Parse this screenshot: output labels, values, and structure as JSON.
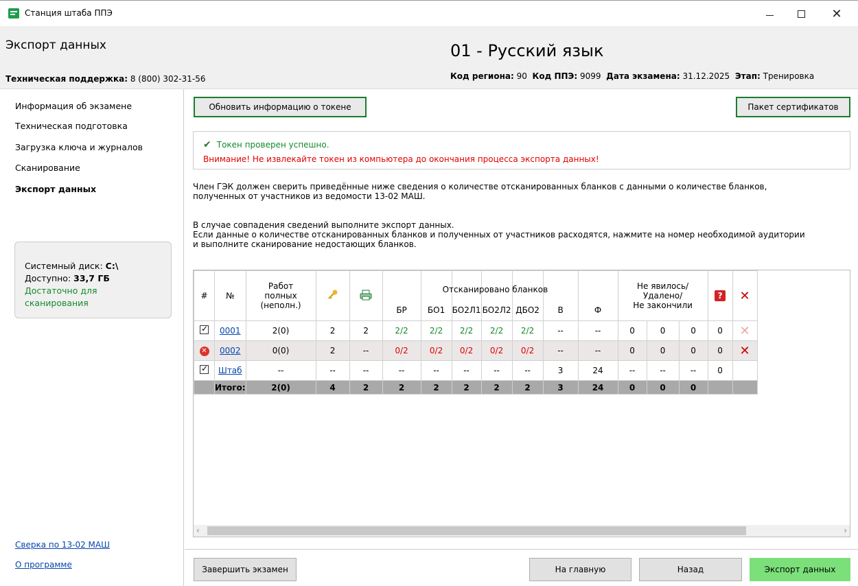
{
  "window": {
    "title": "Станция штаба ППЭ",
    "minimize": "—",
    "maximize": "☐",
    "close": "✕"
  },
  "header": {
    "page_title": "Экспорт данных",
    "support_label": "Техническая поддержка:",
    "support_phone": "8 (800) 302-31-56",
    "subject": "01 - Русский язык",
    "region_label": "Код региона:",
    "region_value": "90",
    "ppe_label": "Код ППЭ:",
    "ppe_value": "9099",
    "date_label": "Дата экзамена:",
    "date_value": "31.12.2025",
    "stage_label": "Этап:",
    "stage_value": "Тренировка"
  },
  "sidebar": {
    "items": [
      {
        "label": "Информация об экзамене"
      },
      {
        "label": "Техническая подготовка"
      },
      {
        "label": "Загрузка ключа и журналов"
      },
      {
        "label": "Сканирование"
      },
      {
        "label": "Экспорт данных"
      }
    ],
    "disk": {
      "system_label": "Системный диск:",
      "system_value": "C:\\",
      "free_label": "Доступно:",
      "free_value": "33,7 ГБ",
      "status": "Достаточно для сканирования"
    },
    "links": {
      "reconcile": "Сверка по 13-02 МАШ",
      "about": "О программе"
    }
  },
  "main": {
    "refresh_token_button": "Обновить информацию о токене",
    "certificates_button": "Пакет сертификатов",
    "token_ok": "Токен проверен успешно.",
    "token_warning": "Внимание! Не извлекайте токен из компьютера до окончания процесса экспорта данных!",
    "info_1": "Член ГЭК должен сверить приведённые ниже сведения о количестве отсканированных бланков с данными о количестве бланков,",
    "info_2": "полученных от участников из ведомости 13-02 МАШ.",
    "info_3": "В случае совпадения сведений выполните экспорт данных.",
    "info_4": "Если данные о количестве отсканированных бланков и полученных от участников расходятся, нажмите на номер необходимой аудитории",
    "info_5": "и выполните сканирование недостающих бланков."
  },
  "table": {
    "headers": {
      "hash": "#",
      "num": "№",
      "works_1": "Работ",
      "works_2": "полных",
      "works_3": "(неполн.)",
      "scanned": "Отсканировано бланков",
      "br": "БР",
      "bo1": "БО1",
      "bo2l1": "БО2Л1",
      "bo2l2": "БО2Л2",
      "dbo2": "ДБО2",
      "v": "В",
      "f": "Ф",
      "absent_1": "Не явилось/",
      "absent_2": "Удалено/",
      "absent_3": "Не закончили",
      "question": "?",
      "delete": "✕"
    },
    "rows": [
      {
        "status": "checked",
        "num": "0001",
        "works": "2(0)",
        "keys": "2",
        "prints": "2",
        "br": "2/2",
        "bo1": "2/2",
        "bo2l1": "2/2",
        "bo2l2": "2/2",
        "dbo2": "2/2",
        "v": "--",
        "f": "--",
        "a1": "0",
        "a2": "0",
        "a3": "0",
        "q": "0"
      },
      {
        "status": "error",
        "num": "0002",
        "works": "0(0)",
        "keys": "2",
        "prints": "--",
        "br": "0/2",
        "bo1": "0/2",
        "bo2l1": "0/2",
        "bo2l2": "0/2",
        "dbo2": "0/2",
        "v": "--",
        "f": "--",
        "a1": "0",
        "a2": "0",
        "a3": "0",
        "q": "0"
      },
      {
        "status": "checked",
        "num": "Штаб",
        "works": "--",
        "keys": "--",
        "prints": "--",
        "br": "--",
        "bo1": "--",
        "bo2l1": "--",
        "bo2l2": "--",
        "dbo2": "--",
        "v": "3",
        "f": "24",
        "a1": "--",
        "a2": "--",
        "a3": "--",
        "q": "0"
      }
    ],
    "total": {
      "label": "Итого:",
      "works": "2(0)",
      "keys": "4",
      "prints": "2",
      "br": "2",
      "bo1": "2",
      "bo2l1": "2",
      "bo2l2": "2",
      "dbo2": "2",
      "v": "3",
      "f": "24",
      "a1": "0",
      "a2": "0",
      "a3": "0"
    }
  },
  "footer": {
    "finish_button": "Завершить экзамен",
    "home_button": "На главную",
    "back_button": "Назад",
    "export_button": "Экспорт данных"
  },
  "icons": {
    "key": "key-icon",
    "printer": "printer-icon",
    "question": "question-icon",
    "delete": "delete-icon"
  },
  "colors": {
    "ok_green": "#138a2a",
    "error_red": "#e00000",
    "export_button": "#7ce07a",
    "total_row": "#a9a9a9"
  }
}
